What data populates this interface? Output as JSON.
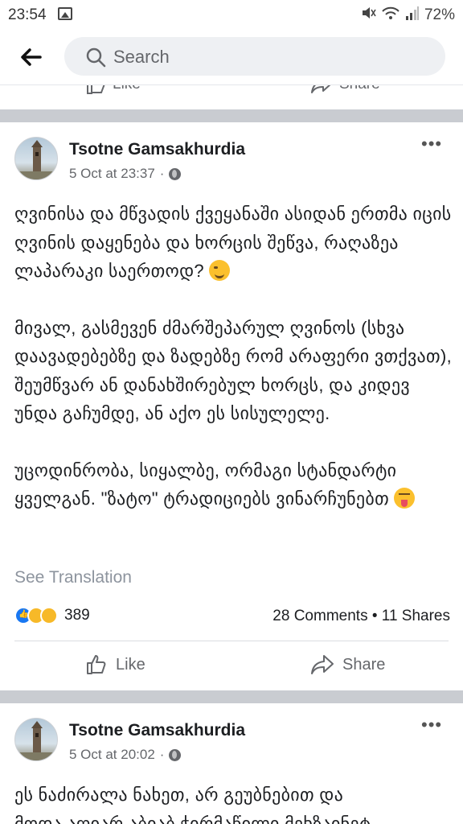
{
  "status_bar": {
    "time": "23:54",
    "battery": "72%",
    "icons": [
      "gallery-icon",
      "mute-icon",
      "wifi-icon",
      "signal-icon"
    ]
  },
  "header": {
    "search_placeholder": "Search",
    "back_icon": "arrow-left-icon"
  },
  "prev_post": {
    "like_label": "Like",
    "share_label": "Share"
  },
  "posts": [
    {
      "author": "Tsotne Gamsakhurdia",
      "date": "5 Oct at 23:37",
      "privacy_separator": "·",
      "paragraphs": [
        "ღვინისა და მწვადის ქვეყანაში ასიდან ერთმა იცის ღვინის დაყენება და ხორცის შეწვა, რაღაზეა ლაპარაკი საერთოდ?",
        "მივალ, გასმევენ ძმარშეპარულ ღვინოს (სხვა დაავადებებზე და ზადებზე რომ არაფერი ვთქვათ), შეუმწვარ ან დანახშირებულ ხორცს, და კიდევ უნდა გაჩუმდე, ან აქო ეს სისულელე.",
        "უცოდინრობა, სიყალბე, ორმაგი სტანდარტი ყველგან. \"ზატო\" ტრადიციებს ვინარჩუნებთ"
      ],
      "see_translation": "See Translation",
      "reaction_count": "389",
      "comments": "28 Comments",
      "shares": "11 Shares",
      "stats_sep": "•",
      "like_label": "Like",
      "share_label": "Share"
    },
    {
      "author": "Tsotne Gamsakhurdia",
      "date": "5 Oct at 20:02",
      "privacy_separator": "·",
      "text_line1": "ეს ნაძირალა ნახეთ, არ გეუბნებით და",
      "text_line2": "მოდა აღიარ აბიაბ ჭირმაწილი მეხზაინეტ"
    }
  ],
  "colors": {
    "brand": "#1877f2",
    "separator": "#c9ccd1",
    "secondary_text": "#65676b"
  }
}
